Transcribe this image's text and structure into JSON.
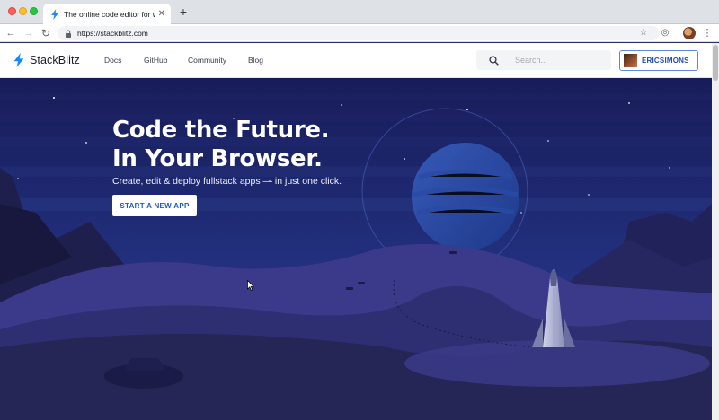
{
  "browser": {
    "tab": {
      "title": "The online code editor for web",
      "close_icon": "close-icon",
      "favicon": "stackblitz-bolt-icon"
    },
    "new_tab_label": "+",
    "url": "https://stackblitz.com",
    "icons": [
      "back-icon",
      "forward-icon",
      "reload-icon",
      "lock-icon",
      "star-icon",
      "extension-icon",
      "profile-icon",
      "menu-icon"
    ]
  },
  "site": {
    "brand": "StackBlitz",
    "nav": [
      "Docs",
      "GitHub",
      "Community",
      "Blog"
    ],
    "search": {
      "placeholder": "Search..."
    },
    "user": {
      "name": "ERICSIMONS"
    }
  },
  "hero": {
    "title_line1": "Code the Future.",
    "title_line2": "In Your Browser.",
    "subtitle": "Create, edit & deploy fullstack apps — in just one click.",
    "cta": "START A NEW APP"
  },
  "colors": {
    "brand_blue": "#1389fd",
    "cta_text": "#1d57c9",
    "sky_top": "#181c59",
    "sky_bottom": "#2a3f9a",
    "dune": "#3b3a8a",
    "foreground": "#252556"
  }
}
